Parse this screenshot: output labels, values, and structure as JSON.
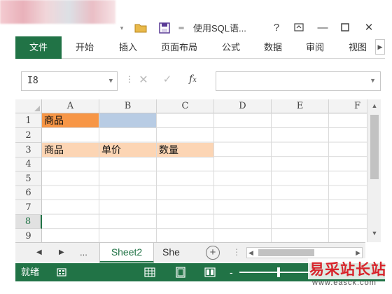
{
  "title_bar": {
    "doc_title": "使用SQL语...",
    "help": "?",
    "minimize": "—",
    "close": "✕"
  },
  "ribbon": {
    "tabs": [
      "文件",
      "开始",
      "插入",
      "页面布局",
      "公式",
      "数据",
      "审阅",
      "视图"
    ]
  },
  "formula_bar": {
    "name_box": "I8",
    "fx": "fx",
    "formula": ""
  },
  "sheet": {
    "columns": [
      "A",
      "B",
      "C",
      "D",
      "E",
      "F"
    ],
    "rows": [
      "1",
      "2",
      "3",
      "4",
      "5",
      "6",
      "7",
      "8",
      "9"
    ],
    "active_row": "8",
    "cells": {
      "A1": "商品",
      "B1": "",
      "A3": "商品",
      "B3": "单价",
      "C3": "数量"
    },
    "colors": {
      "A1": "#f79646",
      "B1": "#b8cce4",
      "row3_fill": "#fcd5b4",
      "accent": "#217346"
    }
  },
  "sheet_tabs": {
    "prev": "◀",
    "next": "▶",
    "more": "...",
    "active": "Sheet2",
    "other": "She",
    "add": "+"
  },
  "status_bar": {
    "ready": "就绪",
    "zoom_minus": "-"
  },
  "watermark": {
    "main": "易采站长站",
    "sub": "www.easck.com"
  }
}
